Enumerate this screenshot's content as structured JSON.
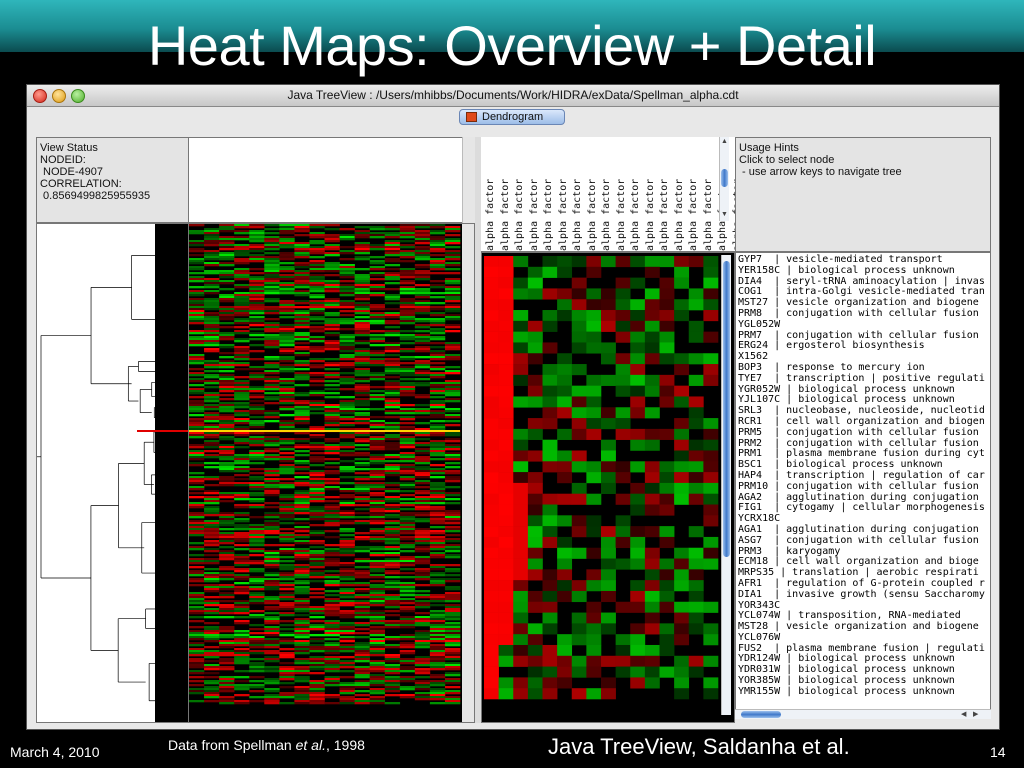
{
  "slide": {
    "title": "Heat Maps: Overview + Detail",
    "date": "March 4, 2010",
    "credit_prefix": "Data from Spellman ",
    "credit_italic": "et al.",
    "credit_suffix": ", 1998",
    "tool_credit": "Java TreeView, Saldanha et al.",
    "page_number": "14"
  },
  "window": {
    "title": "Java TreeView :  /Users/mhibbs/Documents/Work/HIDRA/exData/Spellman_alpha.cdt",
    "toolbar_button": "Dendrogram"
  },
  "view_status": {
    "heading": "View Status",
    "lines": [
      "NODEID:",
      " NODE-4907",
      "CORRELATION:",
      " 0.8569499825955935"
    ]
  },
  "usage_hints": {
    "heading": "Usage Hints",
    "lines": [
      "Click to select node",
      " - use arrow keys to navigate tree"
    ]
  },
  "array_labels": [
    "alpha factor",
    "alpha factor",
    "alpha factor",
    "alpha factor",
    "alpha factor",
    "alpha factor",
    "alpha factor",
    "alpha factor",
    "alpha factor",
    "alpha factor",
    "alpha factor",
    "alpha factor",
    "alpha factor",
    "alpha factor",
    "alpha factor",
    "alpha factor",
    "alpha factor",
    "alpha factor"
  ],
  "genes": [
    "GYP7  | vesicle-mediated transport",
    "YER158C | biological process unknown",
    "DIA4  | seryl-tRNA aminoacylation | invas",
    "COG1  | intra-Golgi vesicle-mediated tran",
    "MST27 | vesicle organization and biogene",
    "PRM8  | conjugation with cellular fusion",
    "YGL052W",
    "PRM7  | conjugation with cellular fusion",
    "ERG24 | ergosterol biosynthesis",
    "X1562",
    "BOP3  | response to mercury ion",
    "TYE7  | transcription | positive regulati",
    "YGR052W | biological process unknown",
    "YJL107C | biological process unknown",
    "SRL3  | nucleobase, nucleoside, nucleotid",
    "RCR1  | cell wall organization and biogen",
    "PRM5  | conjugation with cellular fusion",
    "PRM2  | conjugation with cellular fusion",
    "PRM1  | plasma membrane fusion during cyt",
    "BSC1  | biological process unknown",
    "HAP4  | transcription | regulation of car",
    "PRM10 | conjugation with cellular fusion",
    "AGA2  | agglutination during conjugation",
    "FIG1  | cytogamy | cellular morphogenesis",
    "YCRX18C",
    "AGA1  | agglutination during conjugation",
    "ASG7  | conjugation with cellular fusion",
    "PRM3  | karyogamy",
    "ECM18 | cell wall organization and bioge",
    "MRPS35 | translation | aerobic respirati",
    "AFR1  | regulation of G-protein coupled r",
    "DIA1  | invasive growth (sensu Saccharomy",
    "YOR343C",
    "YCL074W | transposition, RNA-mediated",
    "MST28 | vesicle organization and biogene",
    "YCL076W",
    "FUS2  | plasma membrane fusion | regulati",
    "YDR124W | biological process unknown",
    "YDR031W | biological process unknown",
    "YOR385W | biological process unknown",
    "YMR155W | biological process unknown"
  ],
  "colors": {
    "up": "#ff0000",
    "down": "#00e000",
    "neutral": "#000000",
    "accent": "#3f78c9",
    "slide_band": "#1b8d92"
  },
  "icons": {
    "dendrogram_button": "dendrogram-icon",
    "window_controls": [
      "close-icon",
      "minimize-icon",
      "zoom-icon"
    ]
  }
}
